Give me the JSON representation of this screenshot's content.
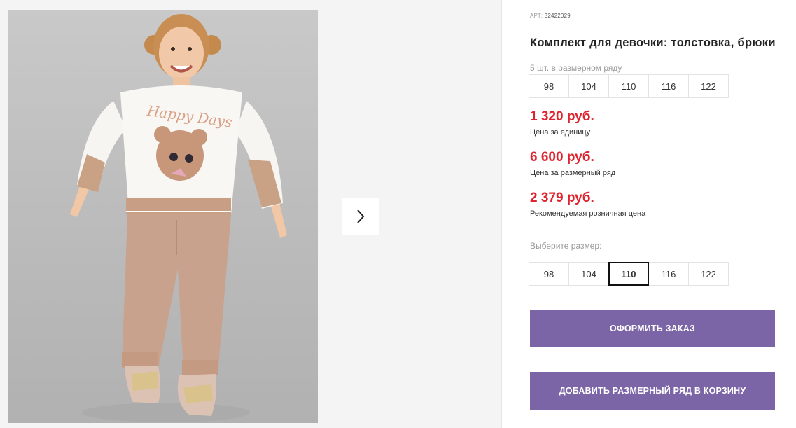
{
  "gallery": {
    "sweater_text": "Happy Days",
    "next_icon": "chevron-right-icon"
  },
  "product": {
    "article_label": "АРТ:",
    "article_number": "32422029",
    "title": "Комплект для девочки: толстовка, брюки",
    "size_row_note": "5 шт. в размерном ряду",
    "size_row": [
      "98",
      "104",
      "110",
      "116",
      "122"
    ],
    "prices": [
      {
        "value": "1 320 руб.",
        "label": "Цена за единицу"
      },
      {
        "value": "6 600 руб.",
        "label": "Цена за размерный ряд"
      },
      {
        "value": "2 379 руб.",
        "label": "Рекомендуемая розничная цена"
      }
    ],
    "choose_size_label": "Выберите размер:",
    "size_options": [
      "98",
      "104",
      "110",
      "116",
      "122"
    ],
    "selected_size": "110",
    "order_button": "Оформить заказ",
    "add_row_button": "Добавить размерный ряд в корзину",
    "colors": {
      "price": "#e0242f",
      "button": "#7b65a6"
    }
  }
}
